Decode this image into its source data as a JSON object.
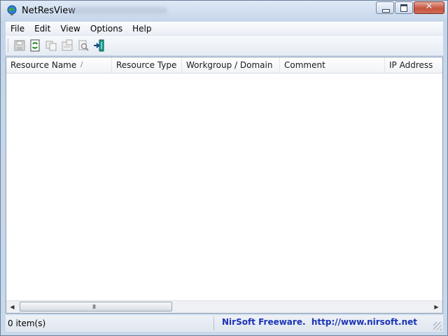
{
  "window": {
    "title": "NetResView"
  },
  "menu": {
    "items": [
      "File",
      "Edit",
      "View",
      "Options",
      "Help"
    ]
  },
  "toolbar": {
    "buttons": [
      {
        "icon": "save-icon",
        "enabled": false
      },
      {
        "icon": "refresh-icon",
        "enabled": true
      },
      {
        "icon": "copy-icon",
        "enabled": false
      },
      {
        "icon": "properties-icon",
        "enabled": false
      },
      {
        "icon": "find-icon",
        "enabled": false
      },
      {
        "icon": "exit-icon",
        "enabled": true
      }
    ]
  },
  "list": {
    "columns": [
      "Resource Name",
      "Resource Type",
      "Workgroup / Domain",
      "Comment",
      "IP Address"
    ],
    "sort_indicator": "/",
    "rows": []
  },
  "scrollbar": {
    "grip": "III"
  },
  "status": {
    "items": "0 item(s)",
    "link": "NirSoft Freeware.  http://www.nirsoft.net",
    "link_color": "#1a33b5"
  },
  "colors": {
    "accent": "#1a33b5",
    "close_button": "#c6553f"
  }
}
